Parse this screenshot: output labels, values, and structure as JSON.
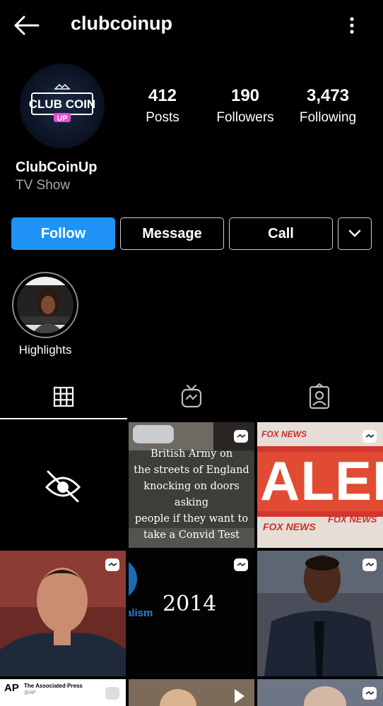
{
  "header": {
    "username": "clubcoinup"
  },
  "profile": {
    "avatar_text_line1": "CLUB COIN",
    "avatar_text_line2": "UP",
    "display_name": "ClubCoinUp",
    "category": "TV Show",
    "stats": [
      {
        "value": "412",
        "label": "Posts"
      },
      {
        "value": "190",
        "label": "Followers"
      },
      {
        "value": "3,473",
        "label": "Following"
      }
    ]
  },
  "actions": {
    "follow": "Follow",
    "message": "Message",
    "call": "Call"
  },
  "highlights": [
    {
      "label": "Highlights"
    }
  ],
  "tabs": [
    {
      "icon": "grid-icon",
      "active": true
    },
    {
      "icon": "igtv-icon",
      "active": false
    },
    {
      "icon": "tagged-icon",
      "active": false
    }
  ],
  "posts": {
    "army_text": [
      "British Army on",
      "the streets of England",
      "knocking on doors asking",
      "people if they want to",
      "take a Convid Test"
    ],
    "fox_brand": "FOX NEWS",
    "alert_text": "ALER",
    "year_text": "2014",
    "partial_text": "alism",
    "ap_logo": "AP",
    "ap_source": "The Associated Press",
    "ap_handle": "@AP"
  },
  "colors": {
    "accent": "#1e93f5",
    "background": "#000000",
    "muted": "#a8a8a8"
  }
}
